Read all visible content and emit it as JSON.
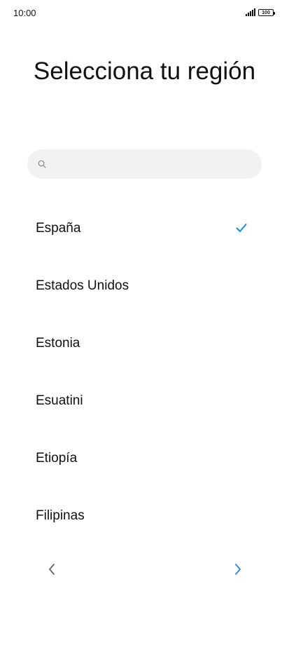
{
  "status_bar": {
    "time": "10:00",
    "battery": "100"
  },
  "title": "Selecciona tu región",
  "search": {
    "placeholder": "",
    "icon": "search-icon"
  },
  "regions": [
    {
      "label": "España",
      "selected": true
    },
    {
      "label": "Estados Unidos",
      "selected": false
    },
    {
      "label": "Estonia",
      "selected": false
    },
    {
      "label": "Esuatini",
      "selected": false
    },
    {
      "label": "Etiopía",
      "selected": false
    },
    {
      "label": "Filipinas",
      "selected": false
    }
  ],
  "navigation": {
    "prev_icon": "chevron-left-icon",
    "next_icon": "chevron-right-icon"
  },
  "colors": {
    "accent": "#1e88e5",
    "prev_arrow": "#666666",
    "search_bg": "#f2f2f2",
    "text": "#111111"
  }
}
